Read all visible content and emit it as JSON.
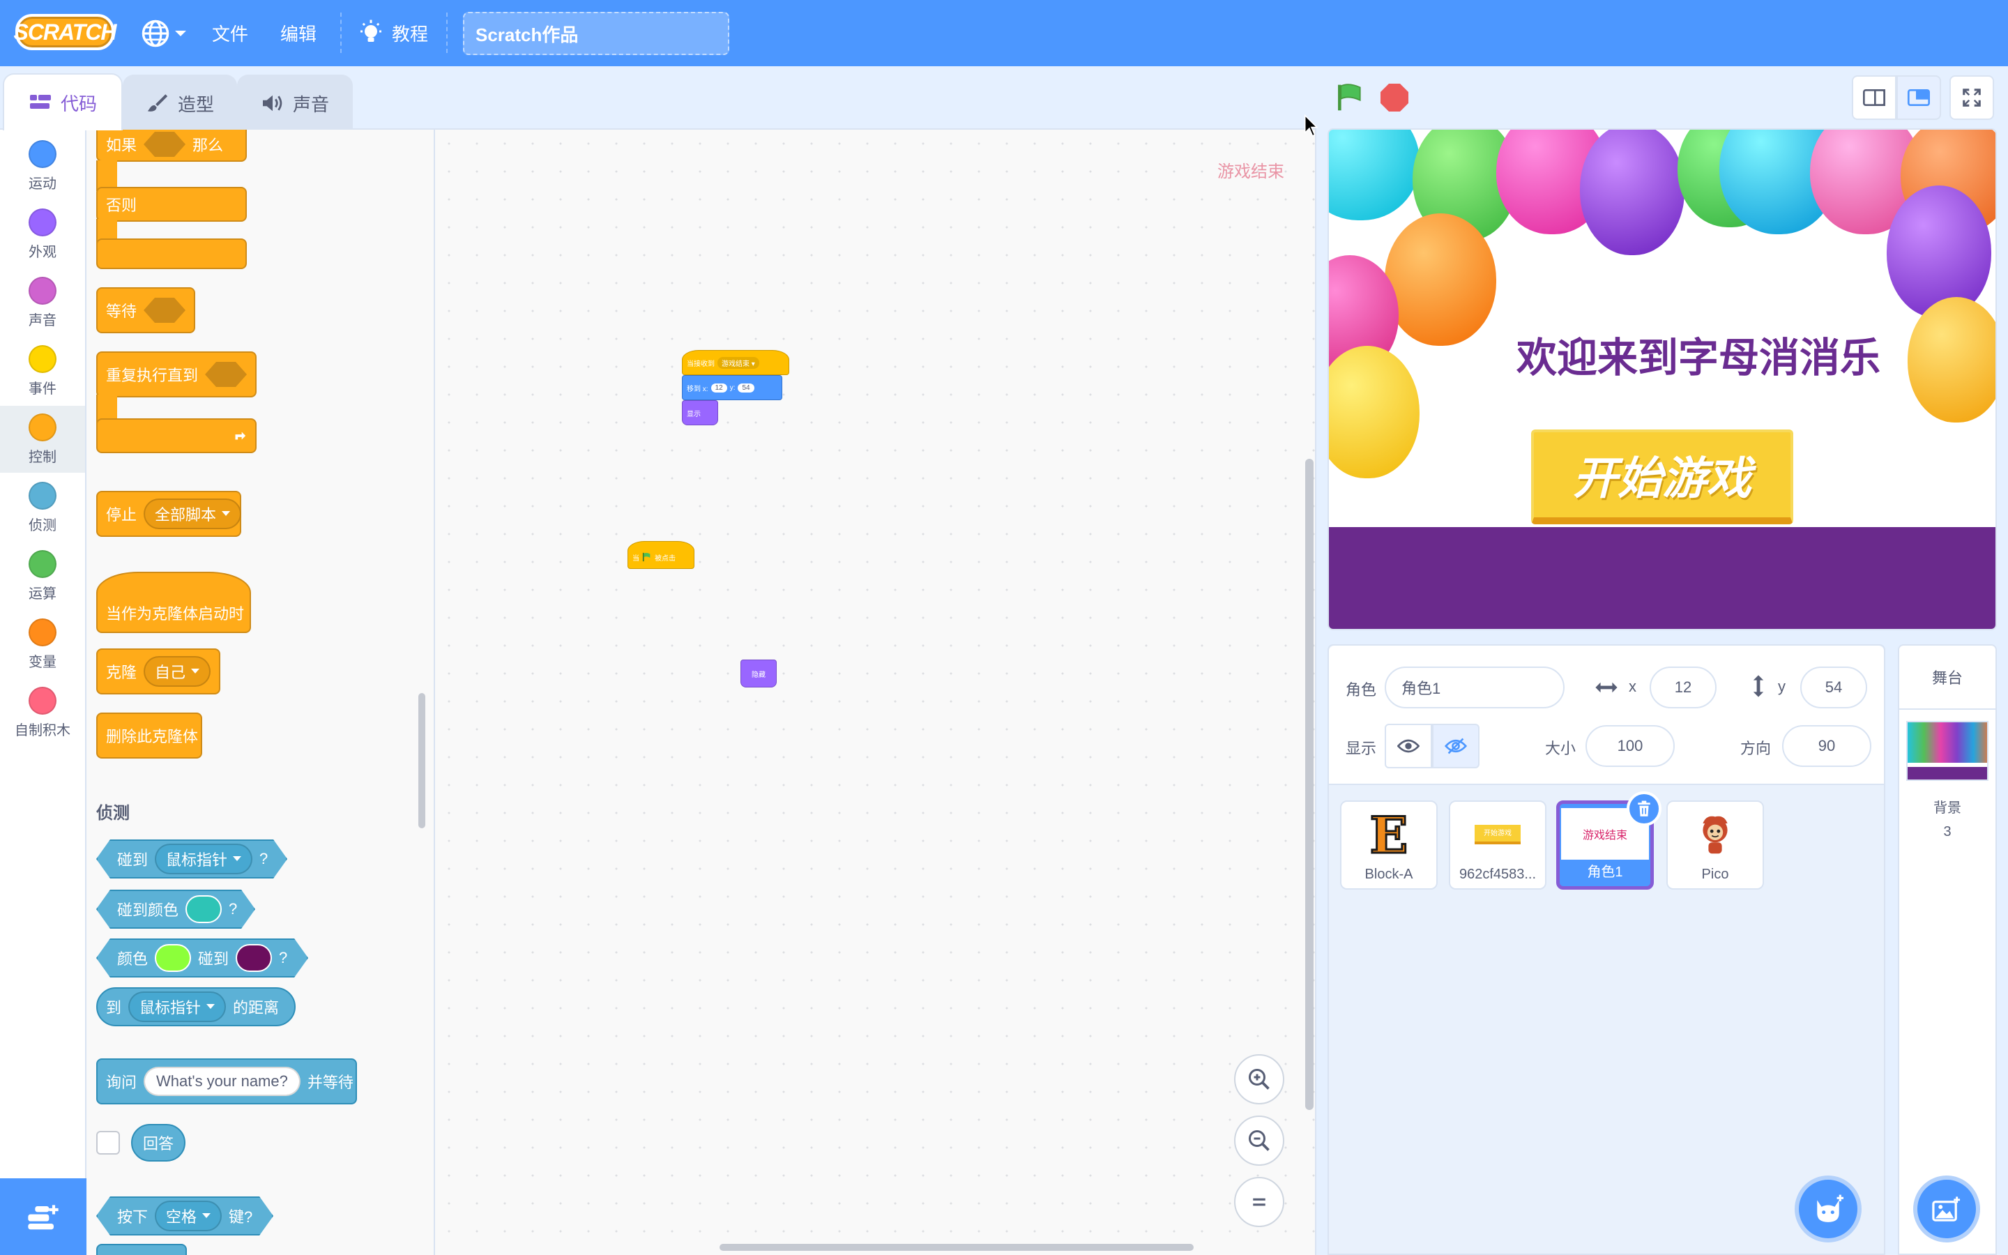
{
  "menu": {
    "logo": "SCRATCH",
    "file": "文件",
    "edit": "编辑",
    "tutorials": "教程",
    "project_title": "Scratch作品"
  },
  "tabs": {
    "code": "代码",
    "costumes": "造型",
    "sounds": "声音"
  },
  "categories": [
    {
      "label": "运动",
      "color": "#4c97ff"
    },
    {
      "label": "外观",
      "color": "#9966ff"
    },
    {
      "label": "声音",
      "color": "#cf63cf"
    },
    {
      "label": "事件",
      "color": "#ffd500"
    },
    {
      "label": "控制",
      "color": "#ffab19"
    },
    {
      "label": "侦测",
      "color": "#5cb1d6"
    },
    {
      "label": "运算",
      "color": "#59c059"
    },
    {
      "label": "变量",
      "color": "#ff8c1a"
    },
    {
      "label": "自制积木",
      "color": "#ff6680"
    }
  ],
  "palette": {
    "if_then": {
      "word1": "如果",
      "word2": "那么"
    },
    "else": "否则",
    "wait": "等待",
    "repeat_until": "重复执行直到",
    "stop": {
      "label": "停止",
      "option": "全部脚本"
    },
    "when_clone": "当作为克隆体启动时",
    "clone": {
      "label": "克隆",
      "option": "自己"
    },
    "delete_clone": "删除此克隆体",
    "sensing_header": "侦测",
    "touching": {
      "label": "碰到",
      "option": "鼠标指针",
      "q": "?"
    },
    "touching_color": {
      "label": "碰到颜色",
      "q": "?",
      "color": "#2ec4b6"
    },
    "color_touching": {
      "label1": "颜色",
      "label2": "碰到",
      "q": "?",
      "color1": "#8cff3a",
      "color2": "#6b0e5d"
    },
    "distance": {
      "label1": "到",
      "option": "鼠标指针",
      "label2": "的距离"
    },
    "ask": {
      "label": "询问",
      "value": "What's your name?",
      "label2": "并等待"
    },
    "answer": "回答",
    "key_pressed": {
      "label": "按下",
      "option": "空格",
      "label2": "键?"
    }
  },
  "script": {
    "watermark": "游戏结束",
    "hat1": {
      "label": "当接收到",
      "option": "游戏结束"
    },
    "motion1": {
      "label": "移到 x:",
      "x": "12",
      "ylabel": "y:",
      "y": "54"
    },
    "looks1": "显示",
    "hat2": {
      "label1": "当",
      "label2": "被点击"
    },
    "looks2": "隐藏"
  },
  "stage": {
    "title": "欢迎来到字母消消乐",
    "button": "开始游戏"
  },
  "sprite_info": {
    "sprite_label": "角色",
    "sprite_name": "角色1",
    "x_label": "x",
    "x": "12",
    "y_label": "y",
    "y": "54",
    "show_label": "显示",
    "size_label": "大小",
    "size": "100",
    "direction_label": "方向",
    "direction": "90"
  },
  "sprites": [
    {
      "name": "Block-A",
      "thumb": "E"
    },
    {
      "name": "962cf4583...",
      "thumb": "开始游戏"
    },
    {
      "name": "角色1",
      "thumb": "游戏结束"
    },
    {
      "name": "Pico",
      "thumb": ""
    }
  ],
  "stage_selector": {
    "header": "舞台",
    "backdrop_label": "背景",
    "backdrop_count": "3"
  }
}
